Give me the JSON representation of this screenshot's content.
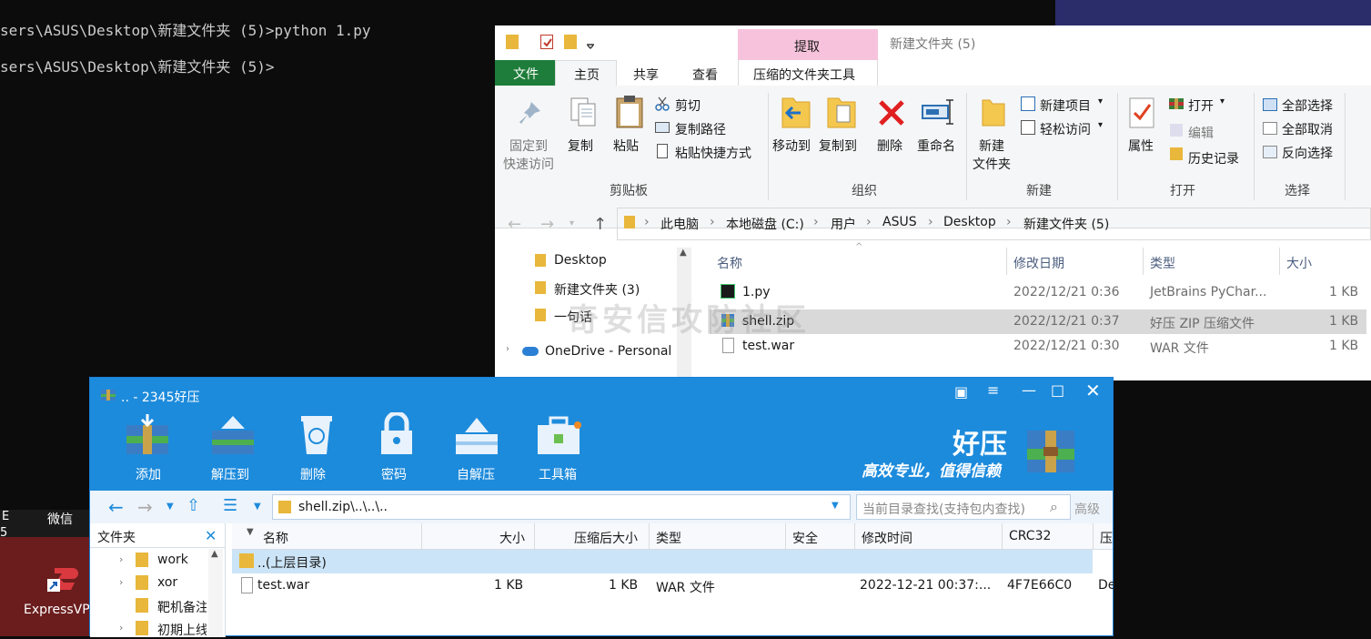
{
  "terminal": {
    "line1": "sers\\ASUS\\Desktop\\新建文件夹 (5)>python 1.py",
    "line2": "sers\\ASUS\\Desktop\\新建文件夹 (5)>"
  },
  "desktop": {
    "left_text_top": "E",
    "left_text_bottom": "5",
    "wechat": "微信",
    "expressvpn": "ExpressVP"
  },
  "explorer": {
    "title": "新建文件夹 (5)",
    "context_tab": "提取",
    "context_tab_sub": "压缩的文件夹工具",
    "tabs": [
      "文件",
      "主页",
      "共享",
      "查看"
    ],
    "ribbon": {
      "pin": "固定到",
      "pin2": "快速访问",
      "copy": "复制",
      "paste": "粘贴",
      "cut": "剪切",
      "copy_path": "复制路径",
      "paste_shortcut": "粘贴快捷方式",
      "move_to": "移动到",
      "copy_to": "复制到",
      "delete": "删除",
      "rename": "重命名",
      "new_folder": "新建",
      "new_folder2": "文件夹",
      "new_item": "新建项目",
      "easy_access": "轻松访问",
      "properties": "属性",
      "open": "打开",
      "edit": "编辑",
      "history": "历史记录",
      "select_all": "全部选择",
      "select_none": "全部取消",
      "invert": "反向选择",
      "groups": [
        "剪贴板",
        "组织",
        "新建",
        "打开",
        "选择"
      ]
    },
    "breadcrumb": [
      "此电脑",
      "本地磁盘 (C:)",
      "用户",
      "ASUS",
      "Desktop",
      "新建文件夹 (5)"
    ],
    "nav": [
      {
        "label": "Desktop"
      },
      {
        "label": "新建文件夹 (3)"
      },
      {
        "label": "一句话"
      },
      {
        "label": "OneDrive - Personal"
      }
    ],
    "columns": [
      "名称",
      "修改日期",
      "类型",
      "大小"
    ],
    "files": [
      {
        "name": "1.py",
        "date": "2022/12/21 0:36",
        "type": "JetBrains PyChar...",
        "size": "1 KB"
      },
      {
        "name": "shell.zip",
        "date": "2022/12/21 0:37",
        "type": "好压 ZIP 压缩文件",
        "size": "1 KB"
      },
      {
        "name": "test.war",
        "date": "2022/12/21 0:30",
        "type": "WAR 文件",
        "size": "1 KB"
      }
    ],
    "watermark": "奇安信攻防社区"
  },
  "haozip": {
    "title": ".. - 2345好压",
    "toolbar": [
      "添加",
      "解压到",
      "删除",
      "密码",
      "自解压",
      "工具箱"
    ],
    "brand": "好压",
    "slogan": "高效专业，值得信赖",
    "path": "shell.zip\\..\\..\\..",
    "search_placeholder": "当前目录查找(支持包内查找)",
    "advanced": "高级",
    "folder_panel": "文件夹",
    "tree": [
      "work",
      "xor",
      "靶机备注",
      "初期上线"
    ],
    "columns": [
      "名称",
      "大小",
      "压缩后大小",
      "类型",
      "安全",
      "修改时间",
      "CRC32",
      "压"
    ],
    "rows": [
      {
        "name": "..(上层目录)",
        "size": "",
        "packed": "",
        "type": "",
        "security": "",
        "modified": "",
        "crc": "",
        "extra": ""
      },
      {
        "name": "test.war",
        "size": "1 KB",
        "packed": "1 KB",
        "type": "WAR 文件",
        "security": "",
        "modified": "2022-12-21 00:37:...",
        "crc": "4F7E66C0",
        "extra": "De"
      }
    ]
  }
}
